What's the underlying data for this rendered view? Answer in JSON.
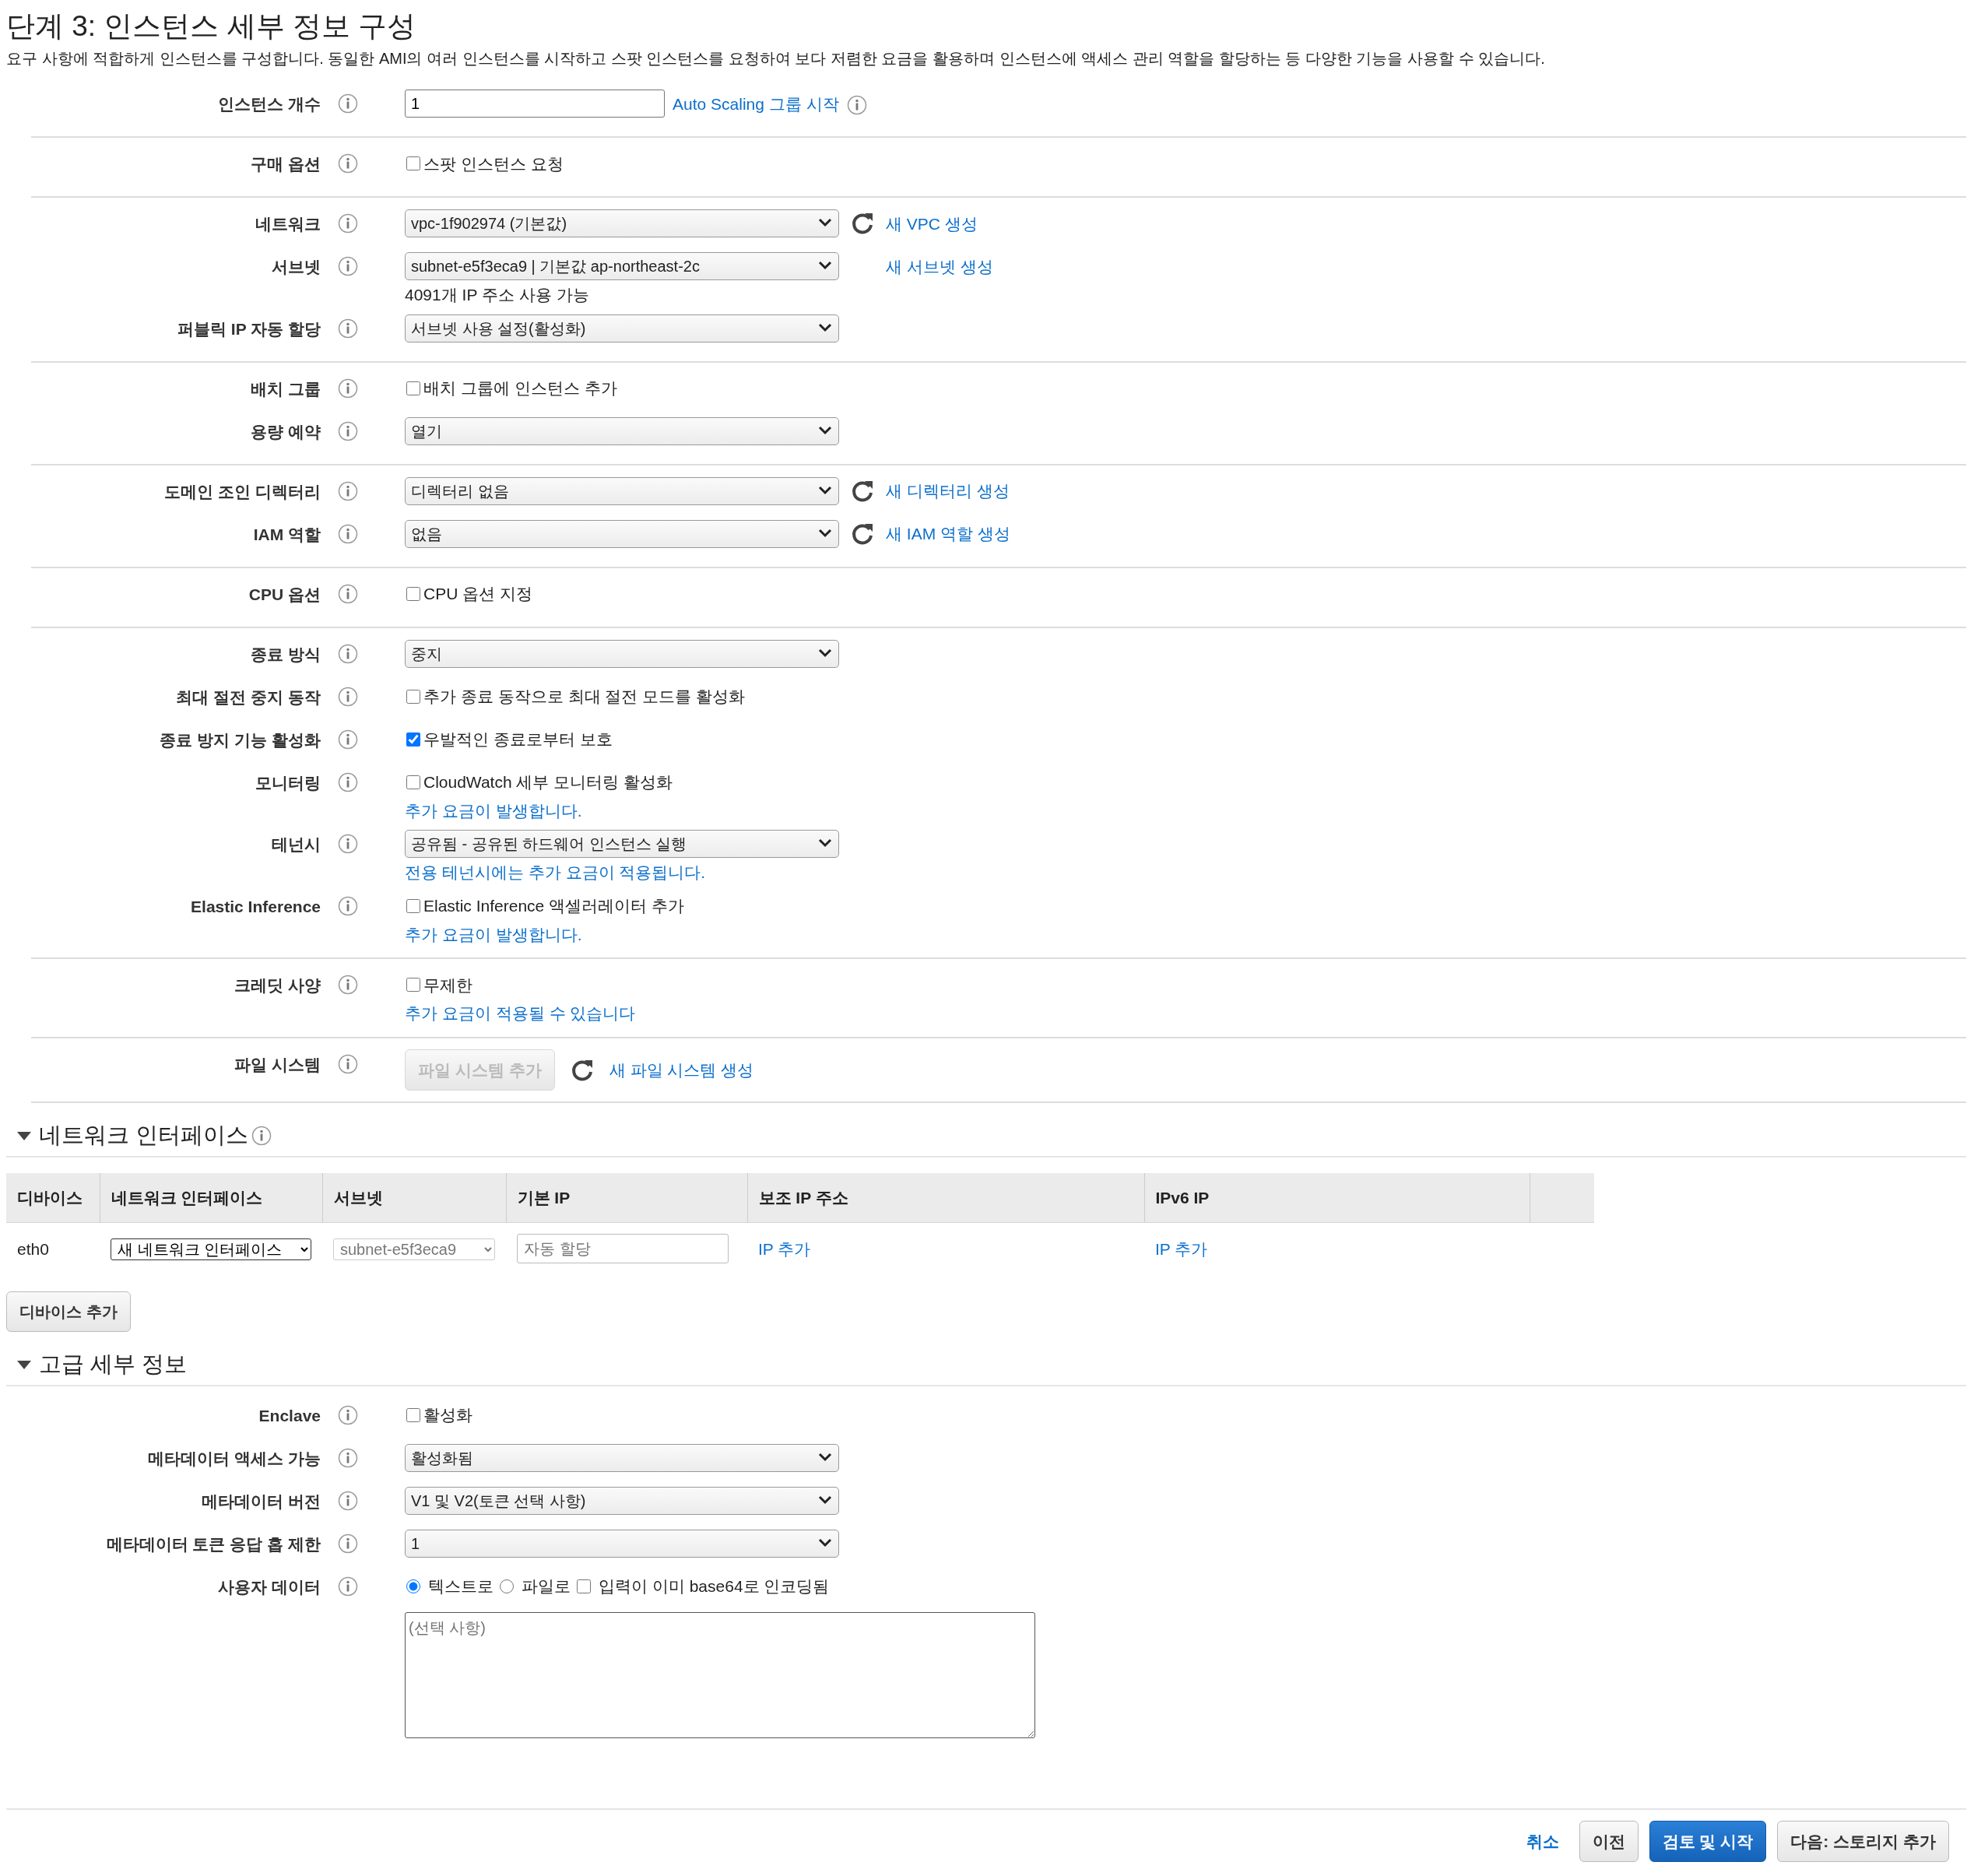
{
  "page": {
    "title": "단계 3: 인스턴스 세부 정보 구성",
    "description": "요구 사항에 적합하게 인스턴스를 구성합니다. 동일한 AMI의 여러 인스턴스를 시작하고 스팟 인스턴스를 요청하여 보다 저렴한 요금을 활용하며 인스턴스에 액세스 관리 역할을 할당하는 등 다양한 기능을 사용할 수 있습니다."
  },
  "sections": [
    {
      "rows": [
        {
          "label": "인스턴스 개수",
          "kind": "input",
          "value": "1",
          "link": "Auto Scaling 그룹 시작",
          "link_info": true
        }
      ]
    },
    {
      "rows": [
        {
          "label": "구매 옵션",
          "kind": "checkbox",
          "text": "스팟 인스턴스 요청",
          "checked": false
        }
      ]
    },
    {
      "rows": [
        {
          "label": "네트워크",
          "kind": "select",
          "value": "vpc-1f902974 (기본값)",
          "refresh": true,
          "link": "새 VPC 생성"
        },
        {
          "label": "서브넷",
          "kind": "select",
          "value": "subnet-e5f3eca9 | 기본값 ap-northeast-2c",
          "link": "새 서브넷 생성",
          "hint": "4091개 IP 주소 사용 가능"
        },
        {
          "label": "퍼블릭 IP 자동 할당",
          "kind": "select",
          "value": "서브넷 사용 설정(활성화)"
        }
      ]
    },
    {
      "rows": [
        {
          "label": "배치 그룹",
          "kind": "checkbox",
          "text": "배치 그룹에 인스턴스 추가",
          "checked": false
        },
        {
          "label": "용량 예약",
          "kind": "select",
          "value": "열기"
        }
      ]
    },
    {
      "rows": [
        {
          "label": "도메인 조인 디렉터리",
          "kind": "select",
          "value": "디렉터리 없음",
          "refresh": true,
          "link": "새 디렉터리 생성"
        },
        {
          "label": "IAM 역할",
          "kind": "select",
          "value": "없음",
          "refresh": true,
          "link": "새 IAM 역할 생성"
        }
      ]
    },
    {
      "rows": [
        {
          "label": "CPU 옵션",
          "kind": "checkbox",
          "text": "CPU 옵션 지정",
          "checked": false
        }
      ]
    },
    {
      "rows": [
        {
          "label": "종료 방식",
          "kind": "select",
          "value": "중지"
        },
        {
          "label": "최대 절전 중지 동작",
          "kind": "checkbox",
          "text": "추가 종료 동작으로 최대 절전 모드를 활성화",
          "checked": false
        },
        {
          "label": "종료 방지 기능 활성화",
          "kind": "checkbox",
          "text": "우발적인 종료로부터 보호",
          "checked": true
        },
        {
          "label": "모니터링",
          "kind": "checkbox",
          "text": "CloudWatch 세부 모니터링 활성화",
          "checked": false,
          "note": "추가 요금이 발생합니다."
        },
        {
          "label": "테넌시",
          "kind": "select",
          "value": "공유됨 - 공유된 하드웨어 인스턴스 실행",
          "note": "전용 테넌시에는 추가 요금이 적용됩니다."
        },
        {
          "label": "Elastic Inference",
          "kind": "checkbox",
          "text": "Elastic Inference 액셀러레이터 추가",
          "checked": false,
          "note": "추가 요금이 발생합니다."
        }
      ]
    },
    {
      "rows": [
        {
          "label": "크레딧 사양",
          "kind": "checkbox",
          "text": "무제한",
          "checked": false,
          "note": "추가 요금이 적용될 수 있습니다"
        }
      ]
    },
    {
      "rows": [
        {
          "label": "파일 시스템",
          "kind": "button",
          "button": "파일 시스템 추가",
          "disabled": true,
          "refresh": true,
          "link": "새 파일 시스템 생성"
        }
      ]
    }
  ],
  "network_interfaces": {
    "title": "네트워크 인터페이스",
    "expanded": true,
    "info": true,
    "columns": [
      "디바이스",
      "네트워크 인터페이스",
      "서브넷",
      "기본 IP",
      "보조 IP 주소",
      "IPv6 IP"
    ],
    "rows": [
      {
        "device": "eth0",
        "interface": "새 네트워크 인터페이스",
        "subnet": "subnet-e5f3eca9",
        "subnet_disabled": true,
        "primary_ip_placeholder": "자동 할당",
        "secondary_ip_link": "IP 추가",
        "ipv6_link": "IP 추가"
      }
    ],
    "add_button": "디바이스 추가"
  },
  "advanced": {
    "title": "고급 세부 정보",
    "expanded": true,
    "rows": [
      {
        "label": "Enclave",
        "kind": "checkbox",
        "text": "활성화",
        "checked": false
      },
      {
        "label": "메타데이터 액세스 가능",
        "kind": "select",
        "value": "활성화됨"
      },
      {
        "label": "메타데이터 버전",
        "kind": "select",
        "value": "V1 및 V2(토큰 선택 사항)"
      },
      {
        "label": "메타데이터 토큰 응답 홉 제한",
        "kind": "select",
        "value": "1"
      },
      {
        "label": "사용자 데이터",
        "kind": "options",
        "options": [
          {
            "kind": "radio",
            "text": "텍스트로",
            "selected": true
          },
          {
            "kind": "radio",
            "text": "파일로",
            "selected": false
          },
          {
            "kind": "checkbox",
            "text": "입력이 이미 base64로 인코딩됨",
            "checked": false
          }
        ],
        "textarea_placeholder": "(선택 사항)"
      }
    ]
  },
  "footer": {
    "cancel": "취소",
    "buttons": [
      {
        "label": "이전",
        "kind": "default"
      },
      {
        "label": "검토 및 시작",
        "kind": "primary"
      },
      {
        "label": "다음: 스토리지 추가",
        "kind": "default"
      }
    ]
  }
}
